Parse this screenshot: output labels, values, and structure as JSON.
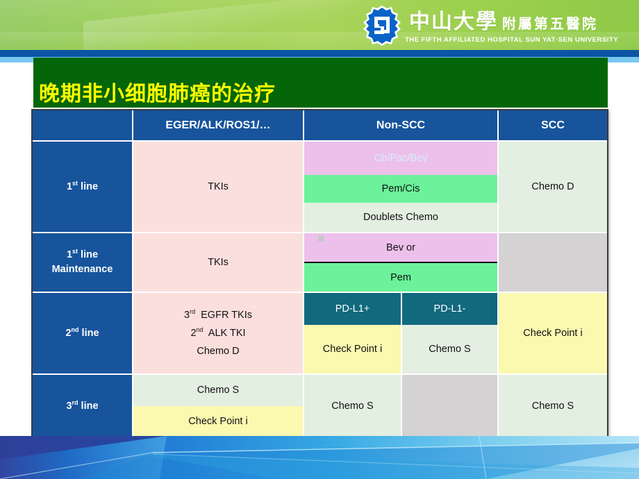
{
  "header": {
    "logo_icon": "sysu-emblem-icon",
    "cn_main": "中山大學",
    "cn_sub": "附屬第五醫院",
    "en_line": "THE FIFTH AFFILIATED HOSPITAL  SUN YAT·SEN UNIVERSITY",
    "banner_color": "#9ccf4e",
    "rule_color": "#0a55a4",
    "rule_light_color": "#78c8f0"
  },
  "title": {
    "text": "晚期非小细胞肺癌的治疗",
    "text_color": "#ffff00",
    "box_color": "#046608"
  },
  "table": {
    "headers": {
      "corner": "",
      "onco": "EGER/ALK/ROS1/…",
      "non_scc": "Non-SCC",
      "scc": "SCC"
    },
    "rows": [
      {
        "line_label_main": "1",
        "line_label_sup": "st",
        "line_label_rest": " line",
        "line_label_second": "",
        "onco": "TKIs",
        "non_scc": [
          {
            "text": "Cb/Pac/Bev",
            "bg": "#edc0ec",
            "fg": "#d8ecf8"
          },
          {
            "text": "Pem/Cis",
            "bg": "#6bf29b",
            "fg": "#111111"
          },
          {
            "text": "Doublets Chemo",
            "bg": "#e3efe1",
            "fg": "#111111"
          }
        ],
        "scc": "Chemo D"
      },
      {
        "line_label_main": "1",
        "line_label_sup": "st",
        "line_label_rest": " line",
        "line_label_second": "Maintenance",
        "onco": "TKIs",
        "non_scc": [
          {
            "text": "Bev or",
            "bg": "#edc0ec",
            "fg": "#111111"
          },
          {
            "text": "Pem",
            "bg": "#6bf29b",
            "fg": "#111111"
          }
        ],
        "scc": ""
      },
      {
        "line_label_main": "2",
        "line_label_sup": "nd",
        "line_label_rest": " line",
        "line_label_second": "",
        "onco_lines": [
          "3rd  EGFR TKIs",
          "2nd  ALK TKI",
          "Chemo D"
        ],
        "non_scc_left": [
          {
            "text": "PD-L1+",
            "bg": "#11697e",
            "fg": "#ffffff"
          },
          {
            "text": "Check Point i",
            "bg": "#fbf8b0",
            "fg": "#111111"
          }
        ],
        "non_scc_right": [
          {
            "text": "PD-L1-",
            "bg": "#11697e",
            "fg": "#ffffff"
          },
          {
            "text": "Chemo S",
            "bg": "#e3efe1",
            "fg": "#111111"
          }
        ],
        "scc": "Check Point i"
      },
      {
        "line_label_main": "3",
        "line_label_sup": "rd",
        "line_label_rest": " line",
        "line_label_second": "",
        "onco_stack": [
          {
            "text": "Chemo S",
            "bg": "#e3efe1",
            "fg": "#111111"
          },
          {
            "text": "Check Point i",
            "bg": "#fbf8b0",
            "fg": "#111111"
          }
        ],
        "non_scc_left": "Chemo S",
        "non_scc_right": "",
        "scc": "Chemo S"
      }
    ]
  }
}
